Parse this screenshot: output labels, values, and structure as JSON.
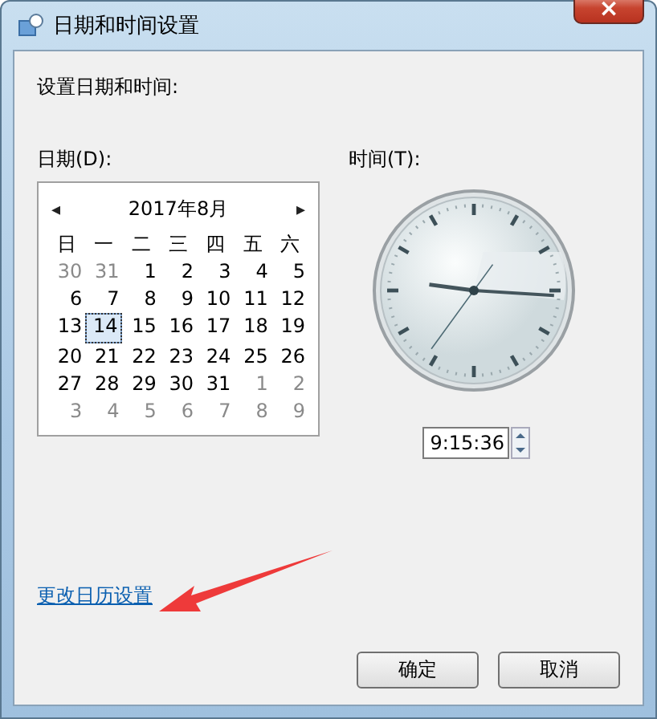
{
  "window": {
    "title": "日期和时间设置",
    "close": "×"
  },
  "heading": "设置日期和时间:",
  "date_label": "日期(D):",
  "time_label": "时间(T):",
  "calendar": {
    "prev": "◂",
    "next": "▸",
    "month": "2017年8月",
    "weekdays": [
      "日",
      "一",
      "二",
      "三",
      "四",
      "五",
      "六"
    ],
    "days": [
      {
        "text": "30",
        "other_month": true,
        "selected": false
      },
      {
        "text": "31",
        "other_month": true,
        "selected": false
      },
      {
        "text": "1",
        "other_month": false,
        "selected": false
      },
      {
        "text": "2",
        "other_month": false,
        "selected": false
      },
      {
        "text": "3",
        "other_month": false,
        "selected": false
      },
      {
        "text": "4",
        "other_month": false,
        "selected": false
      },
      {
        "text": "5",
        "other_month": false,
        "selected": false
      },
      {
        "text": "6",
        "other_month": false,
        "selected": false
      },
      {
        "text": "7",
        "other_month": false,
        "selected": false
      },
      {
        "text": "8",
        "other_month": false,
        "selected": false
      },
      {
        "text": "9",
        "other_month": false,
        "selected": false
      },
      {
        "text": "10",
        "other_month": false,
        "selected": false
      },
      {
        "text": "11",
        "other_month": false,
        "selected": false
      },
      {
        "text": "12",
        "other_month": false,
        "selected": false
      },
      {
        "text": "13",
        "other_month": false,
        "selected": false
      },
      {
        "text": "14",
        "other_month": false,
        "selected": true
      },
      {
        "text": "15",
        "other_month": false,
        "selected": false
      },
      {
        "text": "16",
        "other_month": false,
        "selected": false
      },
      {
        "text": "17",
        "other_month": false,
        "selected": false
      },
      {
        "text": "18",
        "other_month": false,
        "selected": false
      },
      {
        "text": "19",
        "other_month": false,
        "selected": false
      },
      {
        "text": "20",
        "other_month": false,
        "selected": false
      },
      {
        "text": "21",
        "other_month": false,
        "selected": false
      },
      {
        "text": "22",
        "other_month": false,
        "selected": false
      },
      {
        "text": "23",
        "other_month": false,
        "selected": false
      },
      {
        "text": "24",
        "other_month": false,
        "selected": false
      },
      {
        "text": "25",
        "other_month": false,
        "selected": false
      },
      {
        "text": "26",
        "other_month": false,
        "selected": false
      },
      {
        "text": "27",
        "other_month": false,
        "selected": false
      },
      {
        "text": "28",
        "other_month": false,
        "selected": false
      },
      {
        "text": "29",
        "other_month": false,
        "selected": false
      },
      {
        "text": "30",
        "other_month": false,
        "selected": false
      },
      {
        "text": "31",
        "other_month": false,
        "selected": false
      },
      {
        "text": "1",
        "other_month": true,
        "selected": false
      },
      {
        "text": "2",
        "other_month": true,
        "selected": false
      },
      {
        "text": "3",
        "other_month": true,
        "selected": false
      },
      {
        "text": "4",
        "other_month": true,
        "selected": false
      },
      {
        "text": "5",
        "other_month": true,
        "selected": false
      },
      {
        "text": "6",
        "other_month": true,
        "selected": false
      },
      {
        "text": "7",
        "other_month": true,
        "selected": false
      },
      {
        "text": "8",
        "other_month": true,
        "selected": false
      },
      {
        "text": "9",
        "other_month": true,
        "selected": false
      }
    ]
  },
  "time_value": "9:15:36",
  "link": "更改日历设置",
  "buttons": [
    "确定",
    "取消"
  ]
}
